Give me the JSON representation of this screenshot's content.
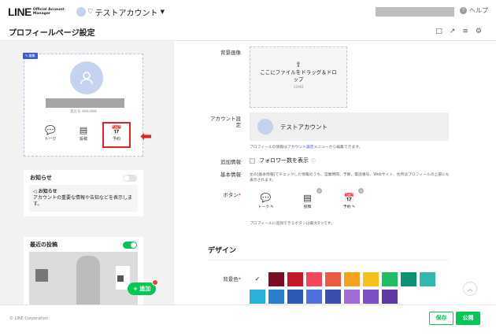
{
  "app": {
    "logo_main": "LINE",
    "logo_sub_1": "Official Account",
    "logo_sub_2": "Manager",
    "account_name": "テストアカウント",
    "help": "ヘルプ"
  },
  "page": {
    "title": "プロフィールページ設定"
  },
  "preview": {
    "edit_badge": "編集",
    "friends": "友だち 999,999",
    "buttons": [
      {
        "label": "トーク",
        "icon": "chat-icon"
      },
      {
        "label": "投稿",
        "icon": "post-icon"
      },
      {
        "label": "予約",
        "icon": "calendar-icon"
      }
    ],
    "notice_title": "お知らせ",
    "notice_sub": "お知らせ",
    "notice_body": "アカウントの重要な情報や告知などを表示します。",
    "posts_title": "最近の投稿",
    "posts_toggle_on": true,
    "add_button": "+ 追加"
  },
  "form": {
    "bg_image_label": "背景画像",
    "drop_text_1": "ここにファイルをドラッグ＆ドロ",
    "drop_text_2": "ップ",
    "drop_size": "10MB",
    "account_label_1": "アカウント設",
    "account_label_2": "定",
    "account_name": "テストアカウント",
    "account_note_pre": "プロフィールの情報は",
    "account_note_link": "アカウント設定",
    "account_note_post": "メニューから編集できます。",
    "extra_label": "追加情報",
    "follower_count": "フォロワー数を表示",
    "basic_label": "基本情報",
    "basic_note": "左の[基本情報]でチェックした情報のうち、営業時間、予算、電話番号、Webサイト、住所はプロフィールの上部にも表示されます。",
    "buttons_label": "ボタン",
    "required_mark": "*",
    "buttons": [
      {
        "label": "トーク",
        "icon": "chat-icon"
      },
      {
        "label": "投稿",
        "icon": "post-icon"
      },
      {
        "label": "予約",
        "icon": "calendar-icon"
      }
    ],
    "buttons_note": "プロフィールに追加できるボタンは最大3つです。",
    "design_title": "デザイン",
    "bg_color_label": "背景色",
    "colors": [
      "#ffffff",
      "#7a0e1e",
      "#c6172b",
      "#f24757",
      "#ec5a3f",
      "#f7a21f",
      "#f6c21a",
      "#21bd65",
      "#109075",
      "#34b7ad",
      "#27b2d8",
      "#2a7fd1",
      "#2f59b8",
      "#4f6fe0",
      "#3d4cb2",
      "#a26cd8",
      "#7d4fc9",
      "#5d3aa8"
    ],
    "selected_color": "#ffffff"
  },
  "footer": {
    "copyright": "© LINE Corporation",
    "save": "保存",
    "publish": "公開"
  }
}
